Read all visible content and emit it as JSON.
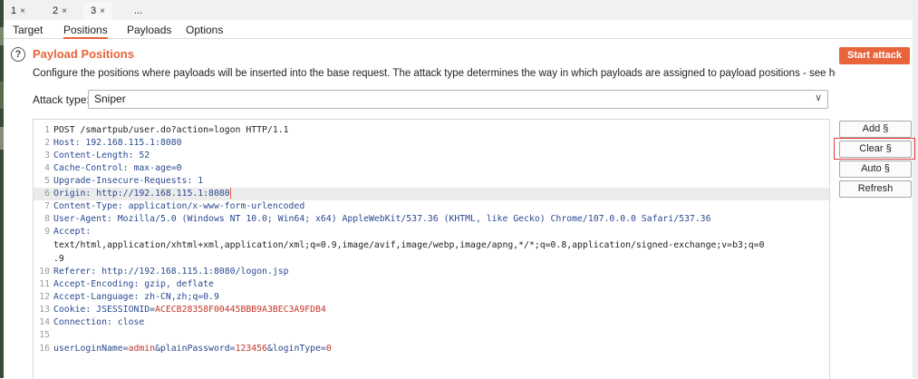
{
  "top_tabs": [
    {
      "label": "1",
      "close": "×"
    },
    {
      "label": "2",
      "close": "×"
    },
    {
      "label": "3",
      "close": "×"
    },
    {
      "label": "...",
      "close": ""
    }
  ],
  "sub_tabs": [
    "Target",
    "Positions",
    "Payloads",
    "Options"
  ],
  "help_icon": "?",
  "section": {
    "title": "Payload Positions",
    "description": "Configure the positions where payloads will be inserted into the base request. The attack type determines the way in which payloads are assigned to payload positions - see help for full details."
  },
  "start_attack_label": "Start attack",
  "attack_type": {
    "label": "Attack type:",
    "value": "Sniper",
    "chevron": "∨"
  },
  "line_numbers": [
    "1",
    "2",
    "3",
    "4",
    "5",
    "6",
    "7",
    "8",
    "9",
    "",
    "",
    "10",
    "11",
    "12",
    "13",
    "14",
    "15",
    "16"
  ],
  "request": {
    "l1": "POST /smartpub/user.do?action=logon HTTP/1.1",
    "l2": "Host: 192.168.115.1:8080",
    "l3": "Content-Length: 52",
    "l4": "Cache-Control: max-age=0",
    "l5": "Upgrade-Insecure-Requests: 1",
    "l6": "Origin: http://192.168.115.1:8080",
    "l7": "Content-Type: application/x-www-form-urlencoded",
    "l8": "User-Agent: Mozilla/5.0 (Windows NT 10.0; Win64; x64) AppleWebKit/537.36 (KHTML, like Gecko) Chrome/107.0.0.0 Safari/537.36",
    "l9a": "Accept:",
    "l9b": "text/html,application/xhtml+xml,application/xml;q=0.9,image/avif,image/webp,image/apng,*/*;q=0.8,application/signed-exchange;v=b3;q=0",
    "l9c": ".9",
    "l10": "Referer: http://192.168.115.1:8080/logon.jsp",
    "l11": "Accept-Encoding: gzip, deflate",
    "l12": "Accept-Language: zh-CN,zh;q=0.9",
    "l13_key": "Cookie: JSESSIONID=",
    "l13_val": "ACECB28358F00445BBB9A3BEC3A9FDB4",
    "l14": "Connection: close",
    "l15": "",
    "l16_k1": "userLoginName=",
    "l16_v1": "admin",
    "l16_k2": "&plainPassword=",
    "l16_v2": "123456",
    "l16_k3": "&loginType=",
    "l16_v3": "0"
  },
  "side_buttons": {
    "add": "Add §",
    "clear": "Clear §",
    "auto": "Auto §",
    "refresh": "Refresh"
  },
  "colors": {
    "accent": "#e8643a",
    "highlight_box": "#e03a3a",
    "payload_value": "#c2372b",
    "header_key": "#2a4a8f"
  }
}
